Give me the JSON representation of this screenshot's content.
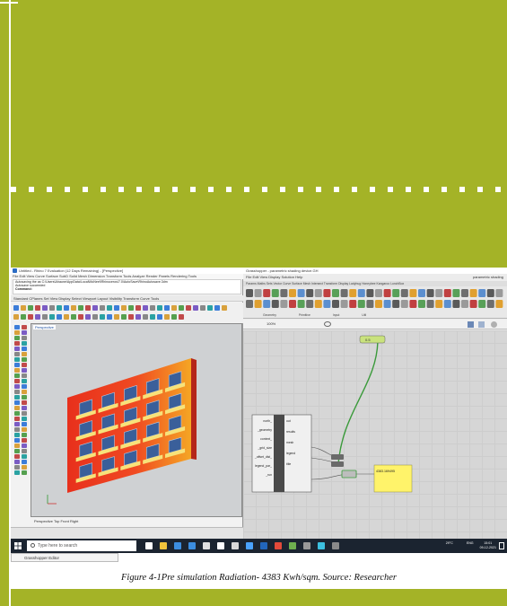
{
  "rhino": {
    "title": "Untitled - Rhino 7 Evaluation (12 Days Remaining) - [Perspective]",
    "menu": "File   Edit   View   Curve   Surface   SubD   Solid   Mesh   Dimension   Transform   Tools   Analyze   Render   Panels   Rendering Tools",
    "command_lines": [
      "Autosaving the as C:\\Users\\Ahaune\\AppData\\Local\\McNeel\\Rhinoceros\\7.0\\AutoSave\\RhinoAutosave.3dm",
      "Autosave succeeded"
    ],
    "command_prompt": "Command:",
    "tabs": "Standard   CPlanes   Set View   Display   Select   Viewport Layout   Visibility   Transform   Curve Tools",
    "viewport_label": "Perspective",
    "viewport_tabs": "Perspective   Top   Front   Right"
  },
  "grasshopper": {
    "title": "Grasshopper - parametric shading device.GH",
    "menu": "File   Edit   View   Display   Solution   Help",
    "doc_name": "parametric shading",
    "ribbon_tabs": "Params   Maths   Sets   Vector   Curve   Surface   Mesh   Intersect   Transform   Display   Ladybug   Honeybee   Kangaroo   LunchBox",
    "ribbon_groups": "Geometry   Primitive   Input   Util",
    "zoom": "100%",
    "inputs": [
      "north_",
      "_geometry",
      "context_",
      "_grid_size",
      "_offset_dist_",
      "legend_par_",
      "_run"
    ],
    "outputs": [
      "out",
      "results",
      "mesh",
      "legend",
      "title"
    ],
    "panel_text": "4383.169495",
    "slider_label": "0.5"
  },
  "taskbar": {
    "search_placeholder": "Type here to search",
    "popup": "Grasshopper Editor",
    "weather": "29°C",
    "lang": "ENG",
    "time": "15:01",
    "date": "09-12-2021"
  },
  "caption": "Figure 4-1Pre simulation Radiation- 4383 Kwh/sqm. Source: Researcher"
}
